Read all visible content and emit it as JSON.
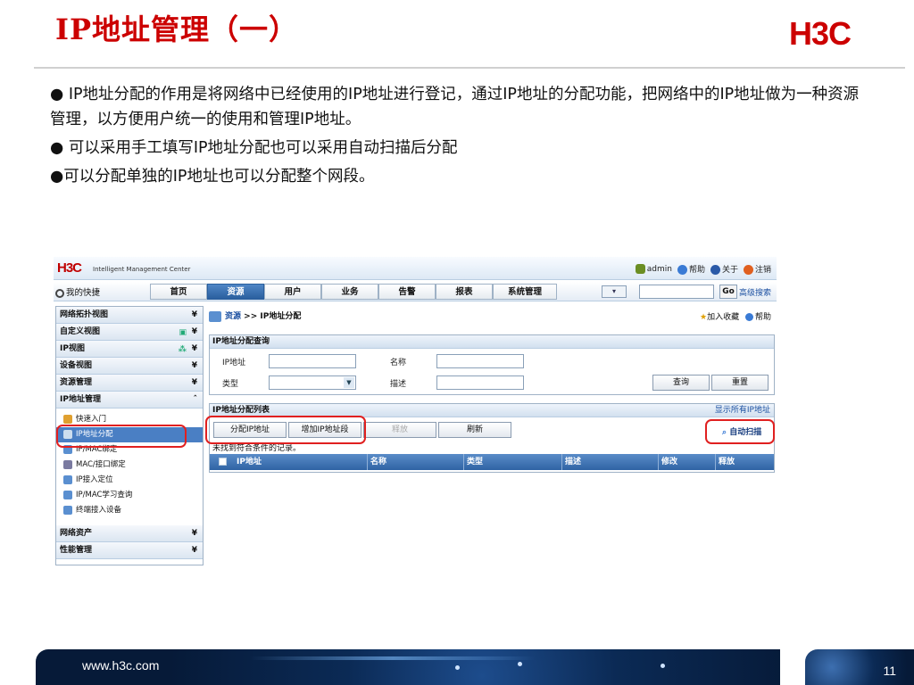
{
  "slide": {
    "title": "IP地址管理（一）",
    "logo_text": "H3C",
    "bullets": [
      "● IP地址分配的作用是将网络中已经使用的IP地址进行登记，通过IP地址的分配功能，把网络中的IP地址做为一种资源管理，以方便用户统一的使用和管理IP地址。",
      "● 可以采用手工填写IP地址分配也可以采用自动扫描后分配",
      "●可以分配单独的IP地址也可以分配整个网段。"
    ],
    "footer_url": "www.h3c.com",
    "page_number": "11"
  },
  "app": {
    "logo": "H3C",
    "logo_sub": "Intelligent Management Center",
    "userbar": {
      "user": "admin",
      "help": "帮助",
      "about": "关于",
      "logout": "注销"
    },
    "shortcut": "我的快捷",
    "tabs": [
      "首页",
      "资源",
      "用户",
      "业务",
      "告警",
      "报表",
      "系统管理"
    ],
    "active_tab": "资源",
    "search": {
      "value": "",
      "go": "Go",
      "advanced": "高级搜索"
    },
    "sidebar": {
      "sections_top": [
        "网络拓扑视图",
        "自定义视图",
        "IP视图",
        "设备视图",
        "资源管理",
        "IP地址管理"
      ],
      "sub_items": [
        "快速入门",
        "IP地址分配",
        "IP/MAC绑定",
        "MAC/接口绑定",
        "IP接入定位",
        "IP/MAC学习查询",
        "终端接入设备"
      ],
      "selected_sub": "IP地址分配",
      "sections_bottom": [
        "网络资产",
        "性能管理"
      ]
    },
    "content": {
      "breadcrumb_root": "资源",
      "breadcrumb_sep": ">>",
      "breadcrumb_page": "IP地址分配",
      "favorite": "加入收藏",
      "help": "帮助",
      "query_panel": {
        "title": "IP地址分配查询",
        "ip_label": "IP地址",
        "name_label": "名称",
        "type_label": "类型",
        "desc_label": "描述",
        "query_button": "查询",
        "reset_button": "重置"
      },
      "list_panel": {
        "title": "IP地址分配列表",
        "show_all": "显示所有IP地址",
        "buttons": {
          "assign_ip": "分配IP地址",
          "add_segment": "增加IP地址段",
          "release": "释放",
          "refresh": "刷新"
        },
        "auto_scan": "自动扫描",
        "empty_message": "未找到符合条件的记录。",
        "columns": [
          "IP地址",
          "名称",
          "类型",
          "描述",
          "修改",
          "释放"
        ]
      }
    }
  }
}
